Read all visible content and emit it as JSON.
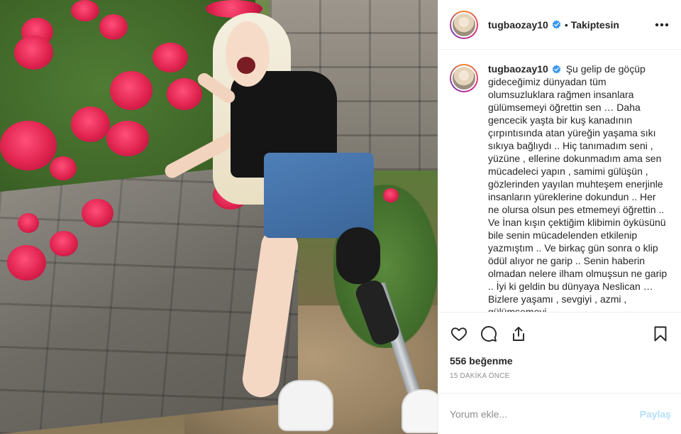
{
  "post": {
    "username": "tugbaozay10",
    "follow_state": "Takiptesin",
    "separator": "•",
    "more_icon": "more-horizontal-icon",
    "caption": "Şu gelip de göçüp gideceğimiz dünyadan tüm olumsuzluklara rağmen insanlara gülümsemeyi öğrettin sen … Daha gencecik yaşta bir kuş kanadının çırpıntısında atan yüreğin yaşama sıkı sıkıya bağlıydı .. Hiç tanımadım seni , yüzüne , ellerine dokunmadım ama sen mücadeleci yapın , samimi gülüşün , gözlerinden yayılan muhteşem enerjinle insanların yüreklerine dokundun .. Her ne olursa olsun pes etmemeyi öğrettin .. Ve İnan kışın çektiğim klibimin öyküsünü bile senin mücadelenden etkilenip yazmıştım .. Ve birkaç gün sonra o klip ödül alıyor ne garip .. Senin haberin olmadan nelere ilham olmuşsun ne garip .. İyi ki geldin bu dünyaya Neslican … Bizlere yaşamı , sevgiyi , azmi , gülümsemeyi ,",
    "likes": "556 beğenme",
    "time": "15 DAKİKA ÖNCE",
    "comment_placeholder": "Yorum ekle...",
    "share_label": "Paylaş"
  },
  "icons": {
    "like": "heart-icon",
    "comment": "comment-icon",
    "share": "share-icon",
    "save": "bookmark-icon",
    "verified": "verified-badge-icon"
  },
  "colors": {
    "verified": "#3897f0",
    "share_disabled": "#b2dffc",
    "meta": "#8e8e8e",
    "border": "#efefef"
  }
}
